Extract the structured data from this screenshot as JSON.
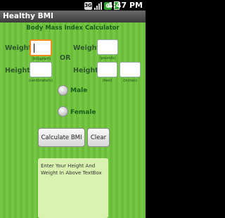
{
  "status_bar": {
    "time": "4:47 PM",
    "icons": [
      "3g-icon",
      "signal-icon",
      "green-g-icon",
      "battery-icon"
    ]
  },
  "app_title": "Healthy BMI",
  "heading": "Body Mass Index Calculator",
  "weight_label": "Weight",
  "height_label": "Height",
  "or_label": "OR",
  "units": {
    "kilogram": "(kilogram)",
    "pounds": "(pounds)",
    "centimeters": "(centimeters)",
    "feet": "(feet)",
    "inches": "(inches)"
  },
  "inputs": {
    "weight_kg": "",
    "weight_lb": "",
    "height_cm": "",
    "height_ft": "",
    "height_in": ""
  },
  "gender": {
    "male": "Male",
    "female": "Female"
  },
  "buttons": {
    "calculate": "Calculate BMI",
    "clear": "Clear"
  },
  "result_text": "Enter Your Height And Weight In Above TextBox",
  "colors": {
    "background": "#6fc43b",
    "heading": "#1b5e1b",
    "focus_border": "#f38a1d",
    "result_panel": "#d9f2b0"
  }
}
